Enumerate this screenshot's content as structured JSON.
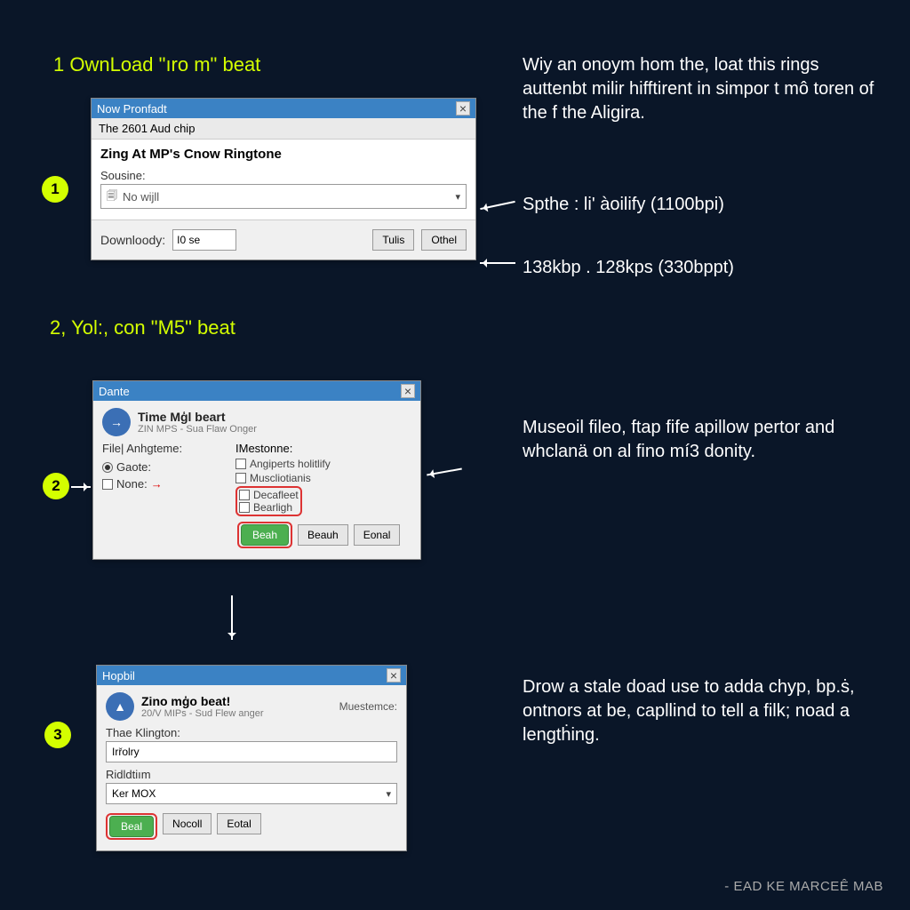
{
  "headings": {
    "h1": "1 OwnLoad \"ıro m\" beat",
    "h2": "2, Yol:, con \"M5\" beat"
  },
  "badges": {
    "b1": "1",
    "b2": "2",
    "b3": "3"
  },
  "dialog1": {
    "titlebar": "Now Pronfadt",
    "subtitle": "The 2601 Aud chip",
    "bold": "Zing At MP's Cnow Ringtone",
    "source_label": "Sousine:",
    "combo_value": "No wijll",
    "download_label": "Downloody:",
    "input_val": "I0 se",
    "btn1": "Tulis",
    "btn2": "Othel"
  },
  "dialog2": {
    "titlebar": "Dante",
    "avatar_glyph": "→",
    "hdr_title": "Time Mģl beart",
    "hdr_sub": "ZIN MPS - Sua Flaw Onger",
    "left_label": "File| Anhgteme:",
    "radio_gaote": "Gaote:",
    "check_none": "None:",
    "group_label": "IMestonne:",
    "opt1": "Angiperts holitlify",
    "opt2": "Muscliotianis",
    "opt3": "Decafleet",
    "opt4": "Bearligh",
    "btn_green": "Beah",
    "btn_b": "Beauh",
    "btn_c": "Eonal"
  },
  "dialog3": {
    "titlebar": "Hopbil",
    "avatar_glyph": "▲",
    "hdr_title": "Zino mģo beat!",
    "hdr_sub": "20/V MIPs - Sud Flew anger",
    "lbl_kington": "Thae Klington:",
    "input_val": "Irřolry",
    "lbl_rd": "Ridldtiım",
    "combo_val": "Ker MOX",
    "btn_green": "Beal",
    "btn_b": "Nocoll",
    "btn_c": "Eotal"
  },
  "right_text": {
    "p1": "Wiy an onoym hom the, loat this rings auttenbt milir hifftirent in simpor t mô toren of the f the Aligira.",
    "p1b": "Spthe : li' àoilify (1100bpi)",
    "p1c": "138kbp . 128kps (330bppt)",
    "p2": "Museoil fileo, ftap fife apillow pertor and whclanä on al fino mí3 donity.",
    "p3": "Drow a stale doad use to adda chyp, bp.ṡ, ontnors at be, capllind to tell a filk; noad a lengtḣing."
  },
  "credit": "- EAD KE MARCEÊ MAB"
}
